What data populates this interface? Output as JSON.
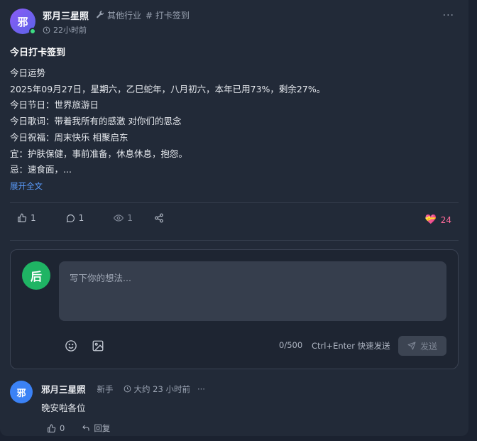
{
  "post": {
    "author": {
      "avatar_text": "邪",
      "name": "邪月三星照",
      "online": true
    },
    "industry": "其他行业",
    "topic": "# 打卡签到",
    "time": "22小时前",
    "more": "···",
    "title": "今日打卡签到",
    "body_lines": [
      "今日运势",
      "2025年09月27日，星期六，乙巳蛇年，八月初六，本年已用73%，剩余27%。",
      "今日节日：世界旅游日",
      "今日歌词：带着我所有的感激 对你们的思念",
      "今日祝福：周末快乐 相聚启东",
      "宜：护肤保健，事前准备，休息休息，抱怨。",
      "忌：速食面，..."
    ],
    "expand_label": "展开全文",
    "stats": {
      "likes": "1",
      "comments": "1",
      "views": "1"
    },
    "reaction": {
      "emoji": "💝",
      "count": "24"
    }
  },
  "composer": {
    "avatar_text": "后",
    "placeholder": "写下你的想法...",
    "counter": "0/500",
    "hint": "Ctrl+Enter 快速发送",
    "send_label": "发送"
  },
  "reply": {
    "avatar_text": "邪",
    "name": "邪月三星照",
    "level": "新手",
    "time": "大约 23 小时前",
    "more": "···",
    "text": "晚安啦各位",
    "likes": "0",
    "reply_label": "回复"
  },
  "colors": {
    "background": "#222a38",
    "accent_link": "#5b9dff",
    "reaction": "#ff6b9a",
    "online": "#3ddc84",
    "composer_avatar": "#1fb464"
  }
}
